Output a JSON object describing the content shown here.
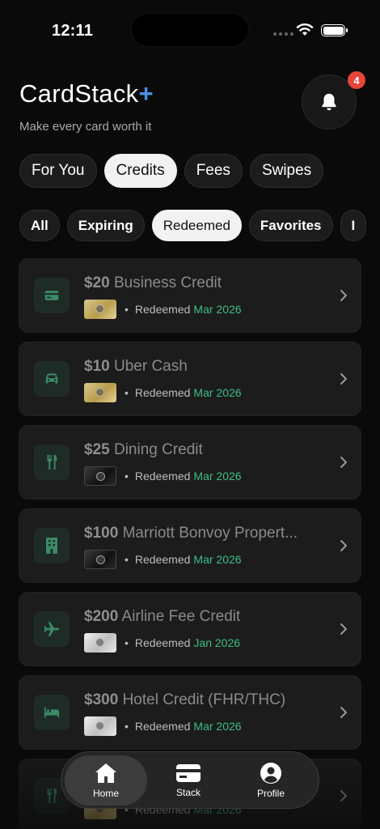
{
  "status_bar": {
    "time": "12:11"
  },
  "header": {
    "app_name": "CardStack",
    "app_name_suffix": "+",
    "subtitle": "Make every card worth it",
    "notification_count": "4"
  },
  "tabs": [
    {
      "label": "For You",
      "active": false
    },
    {
      "label": "Credits",
      "active": true
    },
    {
      "label": "Fees",
      "active": false
    },
    {
      "label": "Swipes",
      "active": false
    }
  ],
  "filters": [
    {
      "label": "All",
      "active": false
    },
    {
      "label": "Expiring",
      "active": false
    },
    {
      "label": "Redeemed",
      "active": true
    },
    {
      "label": "Favorites",
      "active": false
    },
    {
      "label": "I",
      "active": false
    }
  ],
  "credits": [
    {
      "amount": "$20",
      "name": "Business Credit",
      "icon": "credit-card-icon",
      "card": "gold",
      "status": "Redeemed",
      "date": "Mar 2026"
    },
    {
      "amount": "$10",
      "name": "Uber Cash",
      "icon": "car-icon",
      "card": "gold",
      "status": "Redeemed",
      "date": "Mar 2026"
    },
    {
      "amount": "$25",
      "name": "Dining Credit",
      "icon": "fork-knife-icon",
      "card": "black",
      "status": "Redeemed",
      "date": "Mar 2026"
    },
    {
      "amount": "$100",
      "name": "Marriott Bonvoy Propert...",
      "icon": "building-icon",
      "card": "black",
      "status": "Redeemed",
      "date": "Mar 2026"
    },
    {
      "amount": "$200",
      "name": "Airline Fee Credit",
      "icon": "airplane-icon",
      "card": "plat",
      "status": "Redeemed",
      "date": "Jan 2026"
    },
    {
      "amount": "$300",
      "name": "Hotel Credit (FHR/THC)",
      "icon": "bed-icon",
      "card": "plat",
      "status": "Redeemed",
      "date": "Mar 2026"
    },
    {
      "amount": "",
      "name": "",
      "icon": "fork-knife-icon",
      "card": "gold",
      "status": "Redeemed",
      "date": "Mar 2026"
    }
  ],
  "bottom_nav": [
    {
      "label": "Home",
      "icon": "home-icon",
      "active": true
    },
    {
      "label": "Stack",
      "icon": "card-stack-icon",
      "active": false
    },
    {
      "label": "Profile",
      "icon": "profile-icon",
      "active": false
    }
  ],
  "colors": {
    "accent": "#4a90e2",
    "redeemed_date": "#3dbd86",
    "badge": "#e8443a",
    "icon_green": "#3a8a68"
  }
}
